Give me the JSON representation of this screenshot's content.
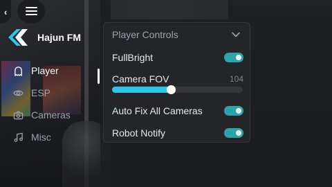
{
  "app": {
    "brand_name": "Hajun FM"
  },
  "sidebar": {
    "items": [
      {
        "label": "Player",
        "icon": "ghost-icon",
        "active": true
      },
      {
        "label": "ESP",
        "icon": "eye-icon",
        "active": false
      },
      {
        "label": "Cameras",
        "icon": "camera-icon",
        "active": false
      },
      {
        "label": "Misc",
        "icon": "music-note-icon",
        "active": false
      }
    ]
  },
  "panel": {
    "title": "Player Controls",
    "fullbright": {
      "label": "FullBright",
      "enabled": true
    },
    "camera_fov": {
      "label": "Camera FOV",
      "value": "104",
      "fraction": 0.43
    },
    "auto_fix": {
      "label": "Auto Fix All Cameras",
      "enabled": true
    },
    "robot_notify": {
      "label": "Robot Notify",
      "enabled": true
    }
  },
  "colors": {
    "accent": "#2fc6e6",
    "toggle": "#2ea3a9",
    "brand": "#2fc6e6"
  }
}
